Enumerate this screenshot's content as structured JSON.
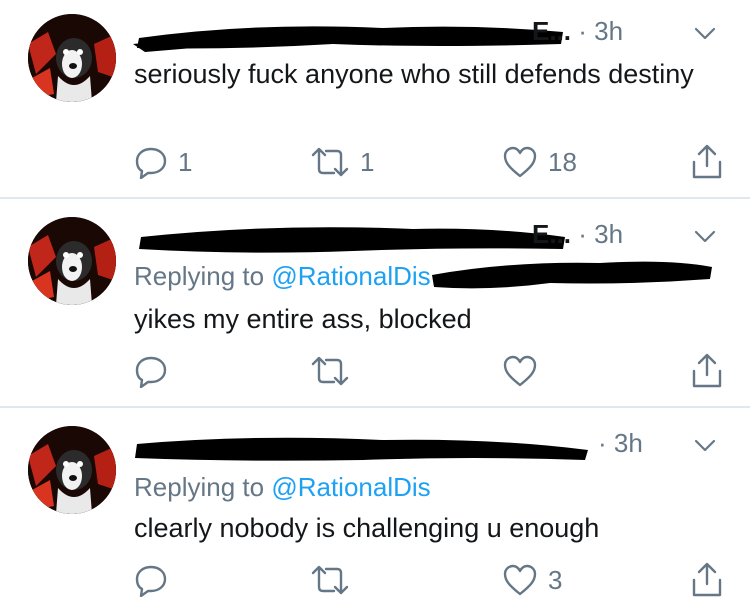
{
  "tweets": [
    {
      "time": "3h",
      "name_suffix": "E...",
      "replying_to_label": "",
      "replying_to_handle": "",
      "text": "seriously fuck anyone who still defends destiny",
      "reply_count": "1",
      "retweet_count": "1",
      "like_count": "18"
    },
    {
      "time": "3h",
      "name_suffix": "E...",
      "replying_to_label": "Replying to",
      "replying_to_handle": "@RationalDis",
      "text": "yikes my entire ass, blocked",
      "reply_count": "",
      "retweet_count": "",
      "like_count": ""
    },
    {
      "time": "3h",
      "name_suffix": "",
      "replying_to_label": "Replying to",
      "replying_to_handle": "@RationalDis",
      "text": "clearly nobody is challenging u enough",
      "reply_count": "",
      "retweet_count": "",
      "like_count": "3"
    }
  ],
  "icons": {
    "reply": "reply-icon",
    "retweet": "retweet-icon",
    "like": "heart-icon",
    "share": "share-icon",
    "more": "chevron-down-icon"
  },
  "colors": {
    "text": "#14171a",
    "secondary": "#657786",
    "link": "#1da1f2",
    "divider": "#e1e8ed",
    "redaction": "#000000"
  }
}
